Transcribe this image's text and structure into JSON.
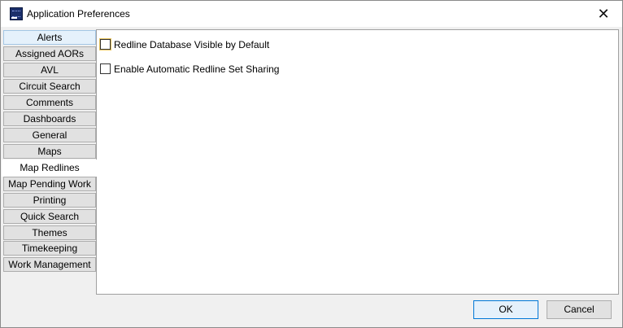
{
  "window": {
    "title": "Application Preferences",
    "close_glyph": "✕"
  },
  "tabs": [
    {
      "label": "Alerts"
    },
    {
      "label": "Assigned AORs"
    },
    {
      "label": "AVL"
    },
    {
      "label": "Circuit Search"
    },
    {
      "label": "Comments"
    },
    {
      "label": "Dashboards"
    },
    {
      "label": "General"
    },
    {
      "label": "Maps"
    },
    {
      "label": "Map Redlines",
      "selected": true
    },
    {
      "label": "Map Pending Work"
    },
    {
      "label": "Printing"
    },
    {
      "label": "Quick Search"
    },
    {
      "label": "Themes"
    },
    {
      "label": "Timekeeping"
    },
    {
      "label": "Work Management"
    }
  ],
  "panel": {
    "options": [
      {
        "label": "Redline Database Visible by Default",
        "checked": false
      },
      {
        "label": "Enable Automatic Redline Set Sharing",
        "checked": false
      }
    ]
  },
  "buttons": {
    "ok": "OK",
    "cancel": "Cancel"
  },
  "colors": {
    "accent": "#0078d7",
    "focus": "#e7c45d"
  }
}
